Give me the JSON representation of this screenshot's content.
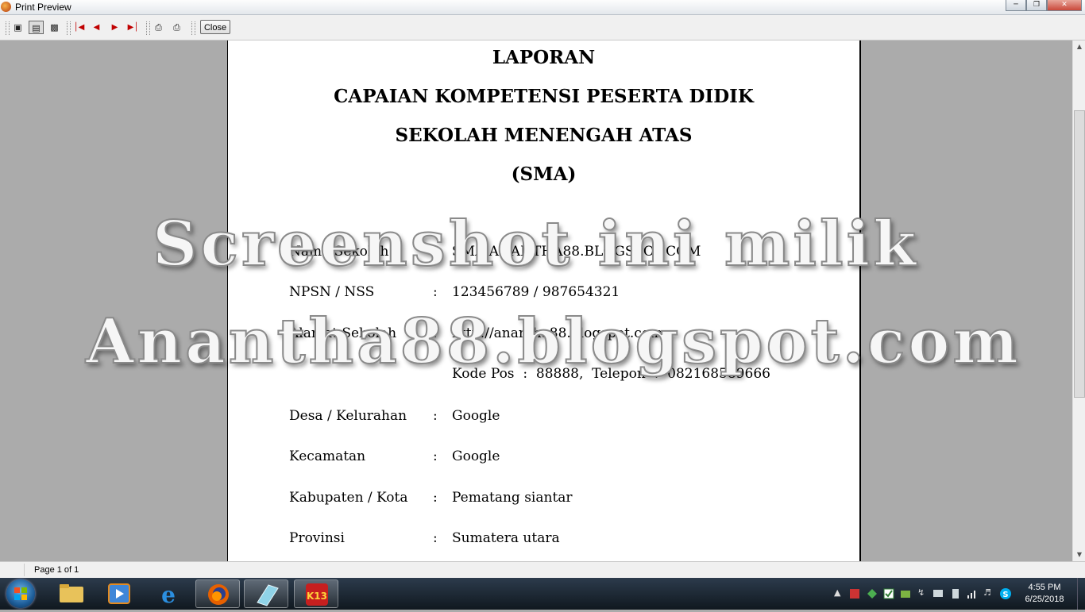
{
  "window": {
    "title": "Print Preview"
  },
  "toolbar": {
    "close_label": "Close"
  },
  "report": {
    "headings": [
      "LAPORAN",
      "CAPAIAN KOMPETENSI PESERTA DIDIK",
      "SEKOLAH MENENGAH ATAS",
      "(SMA)"
    ],
    "rows": [
      {
        "label": "Nama Sekolah",
        "colon": ":",
        "value": "SMA ANANTHA88.BLOGSPOT.COM"
      },
      {
        "label": "NPSN / NSS",
        "colon": ":",
        "value": "123456789 / 987654321"
      },
      {
        "label": "Alamat Sekolah",
        "colon": ":",
        "value": "http://anantha88.blogspot.com"
      },
      {
        "label": "",
        "colon": "",
        "value": "Kode Pos  :  88888,  Telepon  :  082168589666"
      },
      {
        "label": "Desa / Kelurahan",
        "colon": ":",
        "value": "Google"
      },
      {
        "label": "Kecamatan",
        "colon": ":",
        "value": "Google"
      },
      {
        "label": "Kabupaten / Kota",
        "colon": ":",
        "value": "Pematang siantar"
      },
      {
        "label": "Provinsi",
        "colon": ":",
        "value": "Sumatera utara"
      }
    ]
  },
  "watermark": {
    "line1": "Screenshot ini milik",
    "line2": "Anantha88.blogspot.com"
  },
  "status": {
    "page_info": "Page 1 of 1"
  },
  "taskbar": {
    "apps": [
      "windows-explorer",
      "media-player",
      "internet-explorer",
      "firefox",
      "stylus-app",
      "k13-app"
    ],
    "time": "4:55 PM",
    "date": "6/25/2018"
  }
}
